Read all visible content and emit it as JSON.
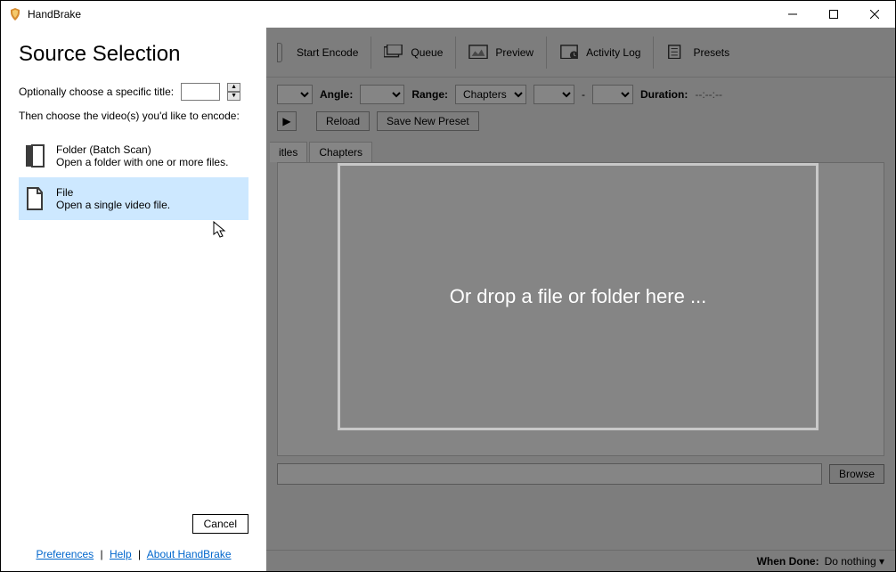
{
  "window": {
    "title": "HandBrake"
  },
  "sidebar": {
    "heading": "Source Selection",
    "specific_title_label": "Optionally choose a specific title:",
    "then_choose": "Then choose the video(s) you'd like to encode:",
    "folder": {
      "title": "Folder (Batch Scan)",
      "sub": "Open a folder with one or more files."
    },
    "file": {
      "title": "File",
      "sub": "Open a single video file."
    },
    "cancel": "Cancel",
    "links": {
      "prefs": "Preferences",
      "help": "Help",
      "about": "About HandBrake"
    }
  },
  "toolbar": {
    "start": "Start Encode",
    "queue": "Queue",
    "preview": "Preview",
    "activity": "Activity Log",
    "presets": "Presets"
  },
  "controls": {
    "angle": "Angle:",
    "range": "Range:",
    "range_mode": "Chapters",
    "dash": "-",
    "duration_label": "Duration:",
    "duration_value": "--:--:--",
    "reload": "Reload",
    "save_preset": "Save New Preset"
  },
  "tabs": {
    "titles": "itles",
    "chapters": "Chapters"
  },
  "browse": "Browse",
  "status": {
    "when_done_label": "When Done:",
    "when_done_value": "Do nothing"
  },
  "dropzone": "Or drop a file or folder here ..."
}
